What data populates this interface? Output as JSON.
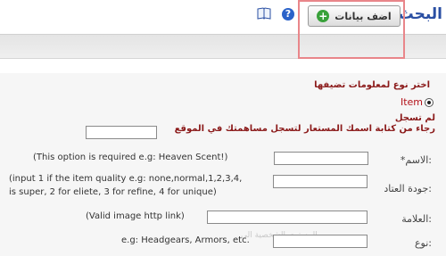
{
  "header": {
    "title": "البحث",
    "add_button_label": "اضف بيانات"
  },
  "form": {
    "instruction": "اختر نوع لمعلومات تضيفها",
    "type_option_label": "Item",
    "not_logged_in": "لم تسجل",
    "register_prompt": "رجاء من كتابة اسمك المستعار لتسجل مساهمتك في الموقع",
    "name_label": "*الاسم:",
    "name_hint": "(This option is required  e.g: Heaven Scent!)",
    "quality_label": "جودة العتاد:",
    "quality_hint_1": "(input 1 if the item quality  e.g: none,normal,1,2,3,4,",
    "quality_hint_2": "is super, 2 for eliete, 3 for refine, 4 for unique)",
    "image_label": "العلامة:",
    "image_hint": "(Valid image http link)",
    "type_label": "نوع:",
    "type_hint": "e.g: Headgears, Armors, etc.",
    "faded_text": "المستوى الشخصية الى"
  },
  "colors": {
    "accent": "#2a4fa3",
    "warning_text": "#8b1a1a",
    "highlight_box": "#e9868a",
    "add_icon": "#39a13a"
  }
}
